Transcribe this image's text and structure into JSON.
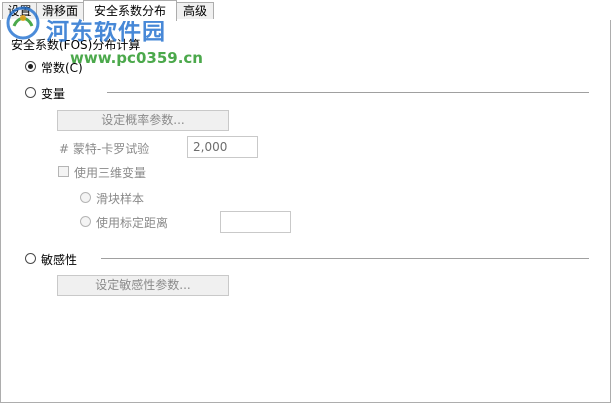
{
  "tabs": [
    {
      "label": "设置",
      "active": false
    },
    {
      "label": "滑移面",
      "active": false
    },
    {
      "label": "安全系数分布",
      "active": true
    },
    {
      "label": "高级",
      "active": false
    }
  ],
  "panel": {
    "section_title": "安全系数(FOS)分布计算",
    "constant_radio": {
      "label": "常数(C)",
      "checked": true
    },
    "variable_radio": {
      "label": "变量",
      "checked": false
    },
    "probability_button": "设定概率参数...",
    "monte_carlo": {
      "label": "# 蒙特-卡罗试验",
      "value": "2,000"
    },
    "use_3d_variable": {
      "label": "使用三维变量",
      "checked": false
    },
    "slider_sample_radio": {
      "label": "滑块样本"
    },
    "marked_distance_radio": {
      "label": "使用标定距离",
      "value": ""
    },
    "sensitivity_radio": {
      "label": "敏感性",
      "checked": false
    },
    "sensitivity_button": "设定敏感性参数..."
  },
  "watermark": {
    "title": "河东软件园",
    "url": "www.pc0359.cn",
    "colors": {
      "title": "#1f6fcf",
      "url": "#2c9a2c"
    }
  }
}
